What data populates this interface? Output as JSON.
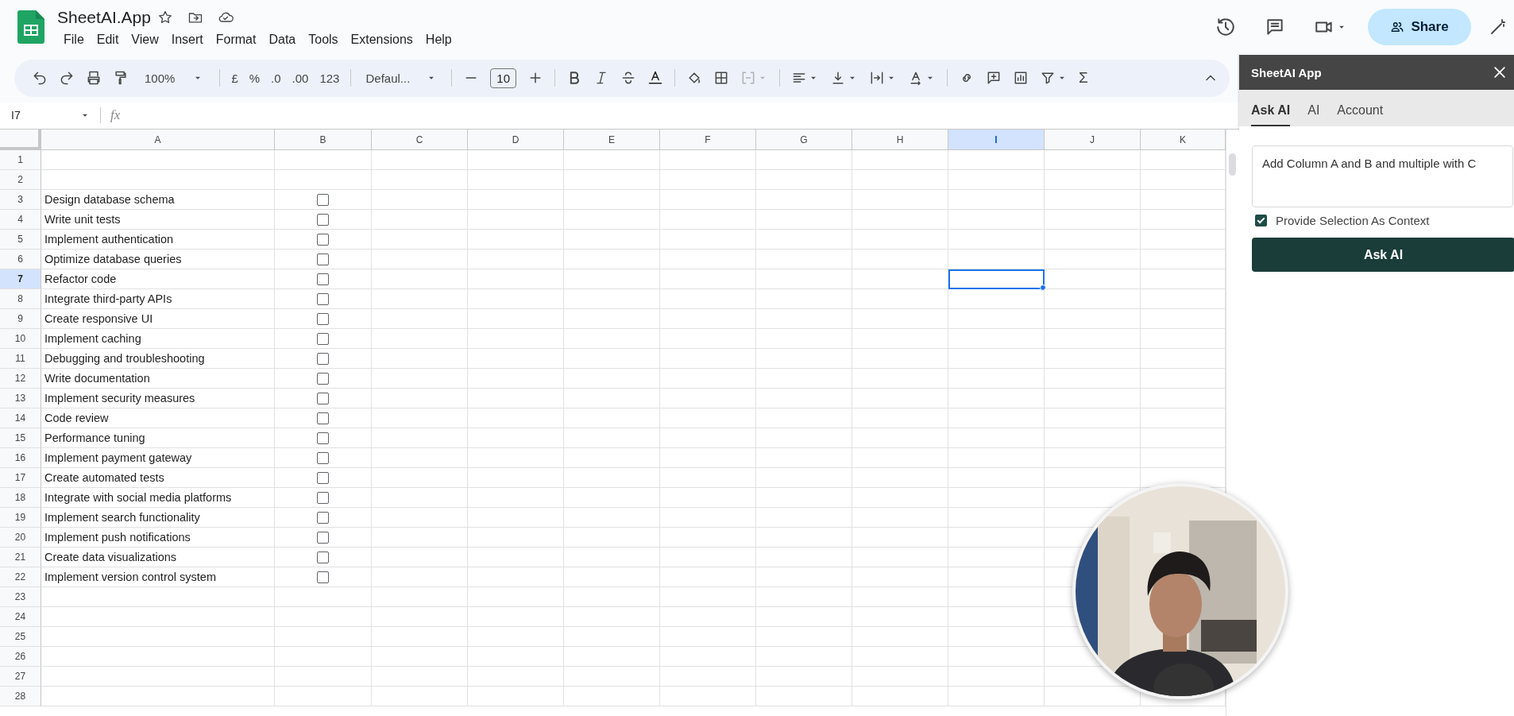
{
  "document": {
    "title": "SheetAI.App",
    "menu": [
      "File",
      "Edit",
      "View",
      "Insert",
      "Format",
      "Data",
      "Tools",
      "Extensions",
      "Help"
    ]
  },
  "share_button": "Share",
  "toolbar": {
    "zoom": "100%",
    "currency": "£",
    "percent": "%",
    "decrease_decimal": ".0",
    "increase_decimal": ".00",
    "number_format": "123",
    "font": "Defaul...",
    "font_size": "10",
    "sum": "Σ"
  },
  "formula_bar": {
    "name_box": "I7",
    "function_label": "fx"
  },
  "grid": {
    "columns": [
      {
        "label": "A",
        "selected": false
      },
      {
        "label": "B",
        "selected": false
      },
      {
        "label": "C",
        "selected": false
      },
      {
        "label": "D",
        "selected": false
      },
      {
        "label": "E",
        "selected": false
      },
      {
        "label": "F",
        "selected": false
      },
      {
        "label": "G",
        "selected": false
      },
      {
        "label": "H",
        "selected": false
      },
      {
        "label": "I",
        "selected": true
      },
      {
        "label": "J",
        "selected": false
      },
      {
        "label": "K",
        "selected": false
      }
    ],
    "rows": [
      {
        "number": "1",
        "selected": false
      },
      {
        "number": "2",
        "selected": false
      },
      {
        "number": "3",
        "selected": false,
        "task": "Design database schema",
        "checked": false
      },
      {
        "number": "4",
        "selected": false,
        "task": "Write unit tests",
        "checked": false
      },
      {
        "number": "5",
        "selected": false,
        "task": "Implement authentication",
        "checked": false
      },
      {
        "number": "6",
        "selected": false,
        "task": "Optimize database queries",
        "checked": false
      },
      {
        "number": "7",
        "selected": true,
        "task": "Refactor code",
        "checked": false
      },
      {
        "number": "8",
        "selected": false,
        "task": "Integrate third-party APIs",
        "checked": false
      },
      {
        "number": "9",
        "selected": false,
        "task": "Create responsive UI",
        "checked": false
      },
      {
        "number": "10",
        "selected": false,
        "task": "Implement caching",
        "checked": false
      },
      {
        "number": "11",
        "selected": false,
        "task": "Debugging and troubleshooting",
        "checked": false
      },
      {
        "number": "12",
        "selected": false,
        "task": "Write documentation",
        "checked": false
      },
      {
        "number": "13",
        "selected": false,
        "task": "Implement security measures",
        "checked": false
      },
      {
        "number": "14",
        "selected": false,
        "task": "Code review",
        "checked": false
      },
      {
        "number": "15",
        "selected": false,
        "task": "Performance tuning",
        "checked": false
      },
      {
        "number": "16",
        "selected": false,
        "task": "Implement payment gateway",
        "checked": false
      },
      {
        "number": "17",
        "selected": false,
        "task": "Create automated tests",
        "checked": false
      },
      {
        "number": "18",
        "selected": false,
        "task": "Integrate with social media platforms",
        "checked": false
      },
      {
        "number": "19",
        "selected": false,
        "task": "Implement search functionality",
        "checked": false
      },
      {
        "number": "20",
        "selected": false,
        "task": "Implement push notifications",
        "checked": false
      },
      {
        "number": "21",
        "selected": false,
        "task": "Create data visualizations",
        "checked": false
      },
      {
        "number": "22",
        "selected": false,
        "task": "Implement version control system",
        "checked": false
      },
      {
        "number": "23",
        "selected": false
      },
      {
        "number": "24",
        "selected": false
      },
      {
        "number": "25",
        "selected": false
      },
      {
        "number": "26",
        "selected": false
      },
      {
        "number": "27",
        "selected": false
      },
      {
        "number": "28",
        "selected": false
      }
    ]
  },
  "panel": {
    "title": "SheetAI App",
    "tabs": [
      {
        "label": "Ask AI",
        "selected": true
      },
      {
        "label": "AI",
        "selected": false
      },
      {
        "label": "Account",
        "selected": false
      }
    ],
    "prompt": "Add Column A and B and multiple with C",
    "context_checkbox": {
      "label": "Provide Selection As Context",
      "checked": true
    },
    "submit_button": "Ask AI"
  }
}
